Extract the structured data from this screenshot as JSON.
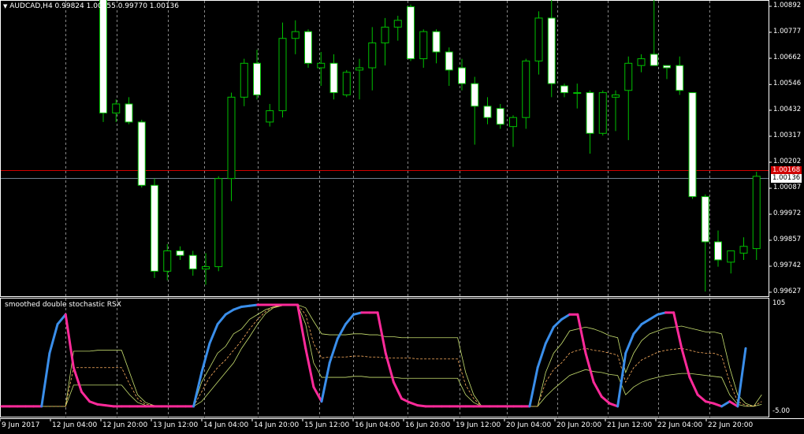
{
  "chart": {
    "symbol_line": "AUDCAD,H4",
    "ohlc_line": "0.99824 1.00155 0.99770 1.00136",
    "price_labels": [
      "1.00892",
      "1.00777",
      "1.00662",
      "1.00546",
      "1.00432",
      "1.00317",
      "1.00202",
      "1.00087",
      "0.99972",
      "0.99857",
      "0.99742",
      "0.99627"
    ],
    "bid_tag": "1.00136",
    "ask_tag": "1.00168",
    "date_labels": [
      "9 Jun 2017",
      "12 Jun 04:00",
      "12 Jun 20:00",
      "13 Jun 12:00",
      "14 Jun 04:00",
      "14 Jun 20:00",
      "15 Jun 12:00",
      "16 Jun 04:00",
      "16 Jun 20:00",
      "19 Jun 12:00",
      "20 Jun 04:00",
      "20 Jun 20:00",
      "21 Jun 12:00",
      "22 Jun 04:00",
      "22 Jun 20:00"
    ],
    "colors": {
      "bull": "#00c000",
      "bear": "#ffffff",
      "ask_line": "#d00000",
      "bid_line": "#708090",
      "separator": "#888888"
    }
  },
  "indicator": {
    "title": "smoothed double stochastic RSX",
    "top_label": "105",
    "bottom_label": "-5.00",
    "colors": {
      "up": "#3a8eea",
      "down": "#ff2a9a",
      "band": "#c8e070",
      "mid": "#ffb060"
    }
  },
  "chart_data": {
    "type": "candlestick",
    "ylim": [
      0.99627,
      1.00892
    ],
    "candles": [
      {
        "o": 1.0114,
        "h": 1.0118,
        "l": 1.0038,
        "c": 1.0042
      },
      {
        "o": 1.0042,
        "h": 1.0048,
        "l": 1.0038,
        "c": 1.0046
      },
      {
        "o": 1.0046,
        "h": 1.0049,
        "l": 1.0037,
        "c": 1.0038
      },
      {
        "o": 1.0038,
        "h": 1.0039,
        "l": 1.0009,
        "c": 1.001
      },
      {
        "o": 1.001,
        "h": 1.0013,
        "l": 0.9969,
        "c": 0.9972
      },
      {
        "o": 0.9972,
        "h": 0.9984,
        "l": 0.9968,
        "c": 0.9981
      },
      {
        "o": 0.9981,
        "h": 0.9983,
        "l": 0.9977,
        "c": 0.9979
      },
      {
        "o": 0.9979,
        "h": 0.9981,
        "l": 0.997,
        "c": 0.9973
      },
      {
        "o": 0.9973,
        "h": 0.998,
        "l": 0.9966,
        "c": 0.9974
      },
      {
        "o": 0.9974,
        "h": 1.0014,
        "l": 0.9972,
        "c": 1.0013
      },
      {
        "o": 1.0013,
        "h": 1.0051,
        "l": 1.0003,
        "c": 1.0049
      },
      {
        "o": 1.0049,
        "h": 1.0066,
        "l": 1.0045,
        "c": 1.0064
      },
      {
        "o": 1.0064,
        "h": 1.007,
        "l": 1.0048,
        "c": 1.005
      },
      {
        "o": 1.0038,
        "h": 1.0046,
        "l": 1.0036,
        "c": 1.0043
      },
      {
        "o": 1.0043,
        "h": 1.0082,
        "l": 1.004,
        "c": 1.0075
      },
      {
        "o": 1.0075,
        "h": 1.0083,
        "l": 1.0068,
        "c": 1.0078
      },
      {
        "o": 1.0078,
        "h": 1.0079,
        "l": 1.0062,
        "c": 1.0064
      },
      {
        "o": 1.0062,
        "h": 1.0069,
        "l": 1.0054,
        "c": 1.0064
      },
      {
        "o": 1.0064,
        "h": 1.0068,
        "l": 1.0048,
        "c": 1.0051
      },
      {
        "o": 1.005,
        "h": 1.0061,
        "l": 1.0049,
        "c": 1.006
      },
      {
        "o": 1.0061,
        "h": 1.0066,
        "l": 1.0048,
        "c": 1.0062
      },
      {
        "o": 1.0062,
        "h": 1.008,
        "l": 1.0052,
        "c": 1.0073
      },
      {
        "o": 1.0073,
        "h": 1.0084,
        "l": 1.0063,
        "c": 1.008
      },
      {
        "o": 1.008,
        "h": 1.0085,
        "l": 1.0074,
        "c": 1.0083
      },
      {
        "o": 1.0089,
        "h": 1.009,
        "l": 1.0065,
        "c": 1.0066
      },
      {
        "o": 1.0066,
        "h": 1.0079,
        "l": 1.0062,
        "c": 1.0078
      },
      {
        "o": 1.0078,
        "h": 1.0079,
        "l": 1.0064,
        "c": 1.0069
      },
      {
        "o": 1.0069,
        "h": 1.0071,
        "l": 1.0054,
        "c": 1.0061
      },
      {
        "o": 1.0062,
        "h": 1.0066,
        "l": 1.0052,
        "c": 1.0055
      },
      {
        "o": 1.0055,
        "h": 1.0058,
        "l": 1.0028,
        "c": 1.0045
      },
      {
        "o": 1.0045,
        "h": 1.0049,
        "l": 1.0037,
        "c": 1.004
      },
      {
        "o": 1.0044,
        "h": 1.0046,
        "l": 1.0035,
        "c": 1.0037
      },
      {
        "o": 1.0036,
        "h": 1.0041,
        "l": 1.0027,
        "c": 1.004
      },
      {
        "o": 1.004,
        "h": 1.0066,
        "l": 1.0035,
        "c": 1.0065
      },
      {
        "o": 1.0065,
        "h": 1.0087,
        "l": 1.0059,
        "c": 1.0084
      },
      {
        "o": 1.0084,
        "h": 1.0092,
        "l": 1.0049,
        "c": 1.0055
      },
      {
        "o": 1.0054,
        "h": 1.0055,
        "l": 1.0049,
        "c": 1.0051
      },
      {
        "o": 1.0051,
        "h": 1.0055,
        "l": 1.0044,
        "c": 1.0051
      },
      {
        "o": 1.0051,
        "h": 1.0052,
        "l": 1.0024,
        "c": 1.0033
      },
      {
        "o": 1.0033,
        "h": 1.0052,
        "l": 1.0032,
        "c": 1.0051
      },
      {
        "o": 1.0049,
        "h": 1.0052,
        "l": 1.0034,
        "c": 1.005
      },
      {
        "o": 1.0052,
        "h": 1.0067,
        "l": 1.003,
        "c": 1.0064
      },
      {
        "o": 1.0063,
        "h": 1.0068,
        "l": 1.006,
        "c": 1.0066
      },
      {
        "o": 1.0068,
        "h": 1.0095,
        "l": 1.0063,
        "c": 1.0063
      },
      {
        "o": 1.0063,
        "h": 1.0063,
        "l": 1.0057,
        "c": 1.0062
      },
      {
        "o": 1.0063,
        "h": 1.0067,
        "l": 1.005,
        "c": 1.0052
      },
      {
        "o": 1.0051,
        "h": 1.0051,
        "l": 1.0004,
        "c": 1.0005
      },
      {
        "o": 1.0005,
        "h": 1.0006,
        "l": 0.9963,
        "c": 0.9985
      },
      {
        "o": 0.9985,
        "h": 0.999,
        "l": 0.9974,
        "c": 0.9977
      },
      {
        "o": 0.9976,
        "h": 0.9981,
        "l": 0.9971,
        "c": 0.9981
      },
      {
        "o": 0.998,
        "h": 0.9987,
        "l": 0.9977,
        "c": 0.9983
      },
      {
        "o": 0.9982,
        "h": 1.0016,
        "l": 0.9977,
        "c": 1.0014
      }
    ],
    "indicator_ylim": [
      -5,
      105
    ],
    "rsx": [
      0,
      0,
      0,
      0,
      0,
      0,
      55,
      85,
      95,
      40,
      15,
      5,
      2,
      1,
      0,
      0,
      0,
      0,
      0,
      0,
      0,
      0,
      0,
      0,
      0,
      35,
      65,
      85,
      95,
      100,
      103,
      104,
      105,
      105,
      105,
      105,
      105,
      105,
      60,
      20,
      5,
      45,
      70,
      85,
      95,
      97,
      97,
      97,
      55,
      25,
      8,
      4,
      1,
      0,
      0,
      0,
      0,
      0,
      0,
      0,
      0,
      0,
      0,
      0,
      0,
      0,
      0,
      40,
      65,
      82,
      90,
      95,
      95,
      55,
      25,
      10,
      3,
      0,
      55,
      75,
      85,
      90,
      95,
      97,
      97,
      60,
      30,
      12,
      5,
      3,
      0,
      5,
      0,
      60
    ],
    "band_upper": [
      0,
      0,
      0,
      0,
      0,
      0,
      0,
      0,
      0,
      57,
      57,
      57,
      58,
      58,
      58,
      58,
      35,
      12,
      4,
      1,
      0,
      0,
      0,
      0,
      0,
      25,
      40,
      55,
      62,
      75,
      80,
      90,
      95,
      100,
      103,
      104,
      105,
      105,
      102,
      88,
      75,
      74,
      74,
      74,
      75,
      75,
      74,
      74,
      72,
      72,
      71,
      71,
      71,
      71,
      71,
      71,
      71,
      71,
      35,
      12,
      0,
      0,
      0,
      0,
      0,
      0,
      0,
      0,
      35,
      55,
      65,
      78,
      80,
      82,
      80,
      77,
      73,
      71,
      35,
      55,
      68,
      75,
      78,
      81,
      82,
      83,
      81,
      79,
      77,
      77,
      75,
      40,
      12,
      3,
      0,
      12
    ],
    "band_mid": [
      0,
      0,
      0,
      0,
      0,
      0,
      0,
      0,
      0,
      40,
      40,
      40,
      40,
      40,
      40,
      40,
      23,
      8,
      2,
      1,
      0,
      0,
      0,
      0,
      0,
      15,
      30,
      40,
      48,
      58,
      68,
      80,
      90,
      98,
      103,
      104,
      105,
      105,
      95,
      65,
      50,
      51,
      51,
      51,
      52,
      52,
      51,
      51,
      50,
      50,
      50,
      50,
      49,
      49,
      49,
      49,
      49,
      49,
      22,
      8,
      0,
      0,
      0,
      0,
      0,
      0,
      0,
      0,
      25,
      38,
      45,
      55,
      58,
      60,
      58,
      57,
      55,
      53,
      25,
      40,
      48,
      52,
      56,
      58,
      59,
      60,
      58,
      56,
      55,
      55,
      52,
      25,
      5,
      1,
      0,
      5
    ],
    "band_lower": [
      0,
      0,
      0,
      0,
      0,
      0,
      0,
      0,
      0,
      22,
      22,
      22,
      22,
      22,
      22,
      22,
      12,
      4,
      1,
      0,
      0,
      0,
      0,
      0,
      0,
      5,
      15,
      25,
      35,
      45,
      60,
      72,
      85,
      96,
      102,
      104,
      105,
      105,
      85,
      45,
      30,
      30,
      30,
      30,
      31,
      31,
      30,
      30,
      30,
      30,
      29,
      29,
      29,
      29,
      29,
      29,
      29,
      29,
      12,
      4,
      0,
      0,
      0,
      0,
      0,
      0,
      0,
      0,
      10,
      18,
      25,
      32,
      35,
      38,
      36,
      35,
      33,
      32,
      12,
      20,
      25,
      28,
      30,
      32,
      33,
      34,
      34,
      33,
      32,
      31,
      30,
      12,
      2,
      0,
      0,
      2
    ]
  }
}
